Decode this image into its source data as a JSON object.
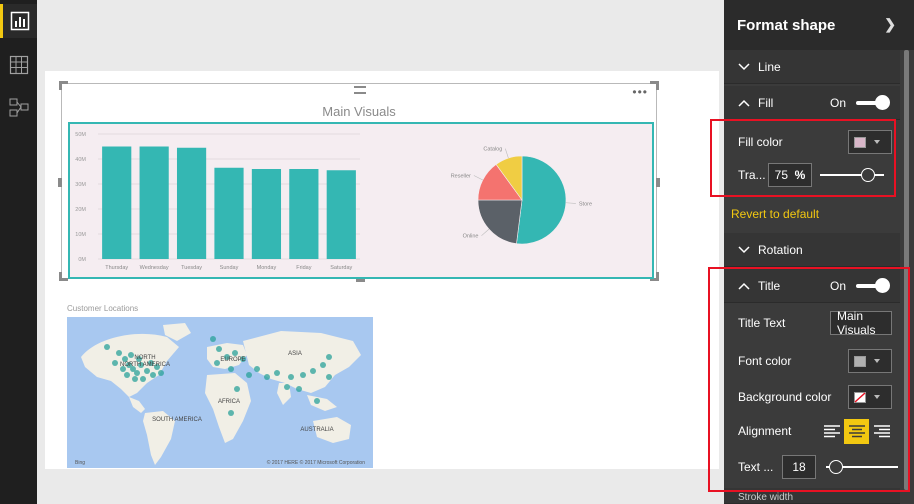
{
  "nav": {
    "items": [
      {
        "icon": "report-view-icon",
        "active": true
      },
      {
        "icon": "data-view-icon",
        "active": false
      },
      {
        "icon": "relationships-view-icon",
        "active": false
      }
    ]
  },
  "shape": {
    "title": "Main Visuals",
    "more_glyph": "•••"
  },
  "chart_data": [
    {
      "type": "bar",
      "title": "",
      "categories": [
        "Thursday",
        "Wednesday",
        "Tuesday",
        "Sunday",
        "Monday",
        "Friday",
        "Saturday"
      ],
      "values": [
        45,
        45,
        44.5,
        36.5,
        36,
        36,
        35.5
      ],
      "ylim": [
        0,
        50
      ],
      "yticks": [
        "0M",
        "10M",
        "20M",
        "30M",
        "40M",
        "50M"
      ],
      "xlabel": "",
      "ylabel": "",
      "color": "#34b7b3"
    },
    {
      "type": "pie",
      "title": "",
      "categories": [
        "Store",
        "Online",
        "Reseller",
        "Catalog"
      ],
      "values": [
        52,
        23,
        15,
        10
      ],
      "colors": [
        "#34b7b3",
        "#5b6168",
        "#f4736f",
        "#f0cd43"
      ]
    }
  ],
  "map": {
    "title": "Customer Locations",
    "labels": {
      "na": "NORTH AMERICA",
      "eu": "EUROPE",
      "as": "ASIA",
      "af": "AFRICA",
      "sa": "SOUTH AMERICA",
      "au": "AUSTRALIA"
    },
    "attribution": "© 2017 HERE   © 2017 Microsoft Corporation",
    "brand": "Bing"
  },
  "pane": {
    "title": "Format shape",
    "sections": {
      "line": "Line",
      "fill": {
        "label": "Fill",
        "state": "On"
      },
      "rotation": "Rotation",
      "title": {
        "label": "Title",
        "state": "On"
      },
      "next": "Stroke width"
    },
    "fill_color_label": "Fill color",
    "fill_color": "#d9b7c9",
    "transparency_label": "Tra...",
    "transparency_value": "75",
    "transparency_unit": "%",
    "transparency_fraction": 0.75,
    "revert": "Revert to default",
    "title_text_label": "Title Text",
    "title_text_value": "Main Visuals",
    "font_color_label": "Font color",
    "font_color": "#b0b0b0",
    "bg_color_label": "Background color",
    "alignment_label": "Alignment",
    "alignment_selected": "center",
    "text_size_label": "Text ...",
    "text_size_value": "18",
    "text_size_fraction": 0.14
  }
}
